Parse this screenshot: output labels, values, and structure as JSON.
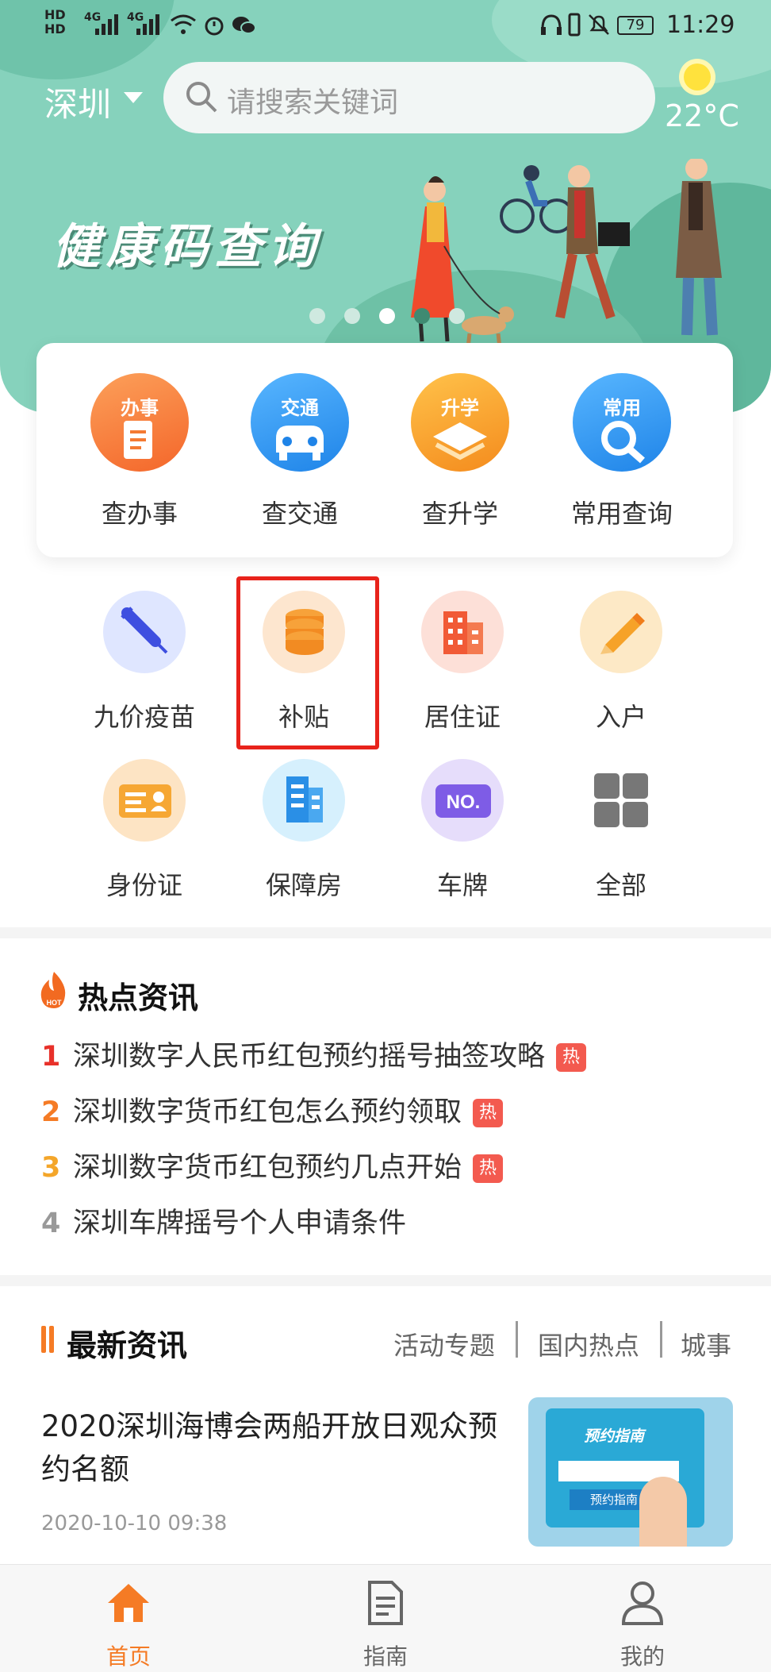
{
  "status_bar": {
    "network_labels": [
      "HD",
      "HD",
      "4G",
      "4G"
    ],
    "battery": "79",
    "time": "11:29"
  },
  "header": {
    "city": "深圳",
    "search_placeholder": "请搜索关键词",
    "temperature": "22°C"
  },
  "banner": {
    "title": "健康码查询",
    "page_count": 5,
    "active_page": 3
  },
  "quick_queries": [
    {
      "badge": "办事",
      "label": "查办事",
      "color": "#f7782f"
    },
    {
      "badge": "交通",
      "label": "查交通",
      "color": "#2f97f0"
    },
    {
      "badge": "升学",
      "label": "查升学",
      "color": "#f7a221"
    },
    {
      "badge": "常用",
      "label": "常用查询",
      "color": "#2f97f0"
    }
  ],
  "services": [
    {
      "label": "九价疫苗",
      "icon": "syringe-icon"
    },
    {
      "label": "补贴",
      "icon": "coins-icon"
    },
    {
      "label": "居住证",
      "icon": "building-icon"
    },
    {
      "label": "入户",
      "icon": "pencil-icon"
    },
    {
      "label": "身份证",
      "icon": "id-card-icon"
    },
    {
      "label": "保障房",
      "icon": "apartment-icon"
    },
    {
      "label": "车牌",
      "icon": "license-plate-icon"
    },
    {
      "label": "全部",
      "icon": "grid-icon"
    }
  ],
  "hot_news": {
    "title": "热点资讯",
    "fire_badge": "HOT",
    "tag": "热",
    "items": [
      {
        "num": "1",
        "text": "深圳数字人民币红包预约摇号抽签攻略",
        "color": "#e8312a"
      },
      {
        "num": "2",
        "text": "深圳数字货币红包怎么预约领取",
        "color": "#f57b25"
      },
      {
        "num": "3",
        "text": "深圳数字货币红包预约几点开始",
        "color": "#f4a62a"
      },
      {
        "num": "4",
        "text": "深圳车牌摇号个人申请条件",
        "color": "#999999"
      }
    ]
  },
  "latest_news": {
    "title": "最新资讯",
    "tabs": [
      "活动专题",
      "国内热点",
      "城事"
    ],
    "article": {
      "title": "2020深圳海博会两船开放日观众预约名额",
      "time": "2020-10-10 09:38",
      "thumb_title": "预约指南",
      "thumb_button": "预约指南"
    }
  },
  "bottom_nav": [
    {
      "label": "首页",
      "active": true
    },
    {
      "label": "指南",
      "active": false
    },
    {
      "label": "我的",
      "active": false
    }
  ],
  "colors": {
    "accent": "#f57b25",
    "teal": "#86d2bc",
    "highlight_box": "#e8231b"
  }
}
